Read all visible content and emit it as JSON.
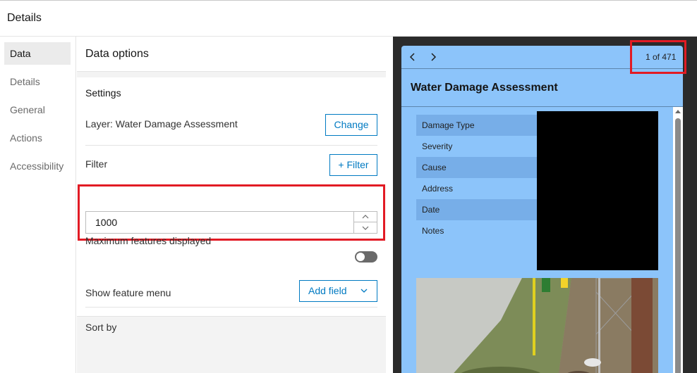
{
  "header": {
    "title": "Details"
  },
  "nav": {
    "items": [
      {
        "label": "Data"
      },
      {
        "label": "Details"
      },
      {
        "label": "General"
      },
      {
        "label": "Actions"
      },
      {
        "label": "Accessibility"
      }
    ],
    "active": "Data"
  },
  "panel": {
    "title": "Data options",
    "settings": {
      "title": "Settings",
      "layer_label": "Layer: Water Damage Assessment",
      "change_label": "Change",
      "filter_label": "Filter",
      "add_filter_label": "+ Filter",
      "max_features_label": "Maximum features displayed",
      "max_features_value": "1000",
      "show_menu_label": "Show feature menu",
      "show_menu_enabled": false,
      "sort_label": "Sort by",
      "add_field_label": "Add field"
    }
  },
  "preview": {
    "counter": "1 of 471",
    "popup_title": "Water Damage Assessment",
    "fields": [
      {
        "label": "Damage Type"
      },
      {
        "label": "Severity"
      },
      {
        "label": "Cause"
      },
      {
        "label": "Address"
      },
      {
        "label": "Date"
      },
      {
        "label": "Notes"
      }
    ],
    "background_color": "#8cc4fa"
  },
  "colors": {
    "accent": "#007ac2",
    "highlight": "#e21b24"
  }
}
